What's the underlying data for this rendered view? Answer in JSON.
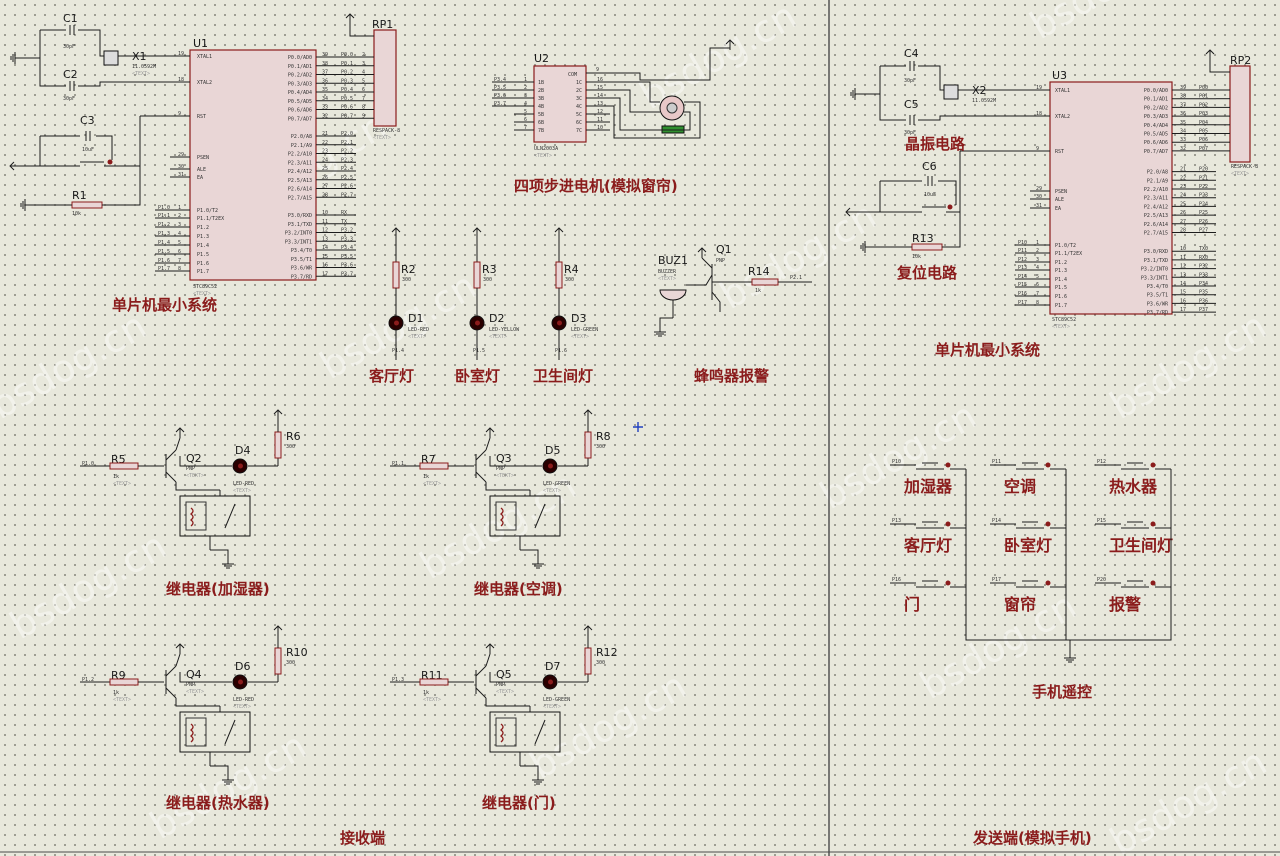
{
  "watermark": "bsdog.cn",
  "placeholder": "<TEXT>",
  "receiver": {
    "footer": "接收端",
    "mcu_section": "单片机最小系统",
    "stepper_section": "四项步进电机(模拟窗帘)",
    "buzzer_section": "蜂鸣器报警",
    "light_labels": [
      "客厅灯",
      "卧室灯",
      "卫生间灯"
    ],
    "relay_labels": [
      "继电器(加湿器)",
      "继电器(空调)",
      "继电器(热水器)",
      "继电器(门)"
    ]
  },
  "sender": {
    "footer": "发送端(模拟手机)",
    "mcu_section": "单片机最小系统",
    "crystal_label": "晶振电路",
    "reset_label": "复位电路",
    "remote_label": "手机遥控",
    "buttons": [
      "加湿器",
      "空调",
      "热水器",
      "客厅灯",
      "卧室灯",
      "卫生间灯",
      "门",
      "窗帘",
      "报警"
    ],
    "button_nets": [
      "P10",
      "P11",
      "P12",
      "P13",
      "P14",
      "P15",
      "P16",
      "P17",
      "P20"
    ]
  },
  "mcu_u1": {
    "ref": "U1",
    "part": "STC89C52",
    "left_pins": [
      "XTAL1",
      "XTAL2",
      "RST",
      "PSEN",
      "ALE",
      "EA",
      "P1.0/T2",
      "P1.1/T2EX",
      "P1.2",
      "P1.3",
      "P1.4",
      "P1.5",
      "P1.6",
      "P1.7"
    ],
    "left_nums": [
      "19",
      "18",
      "9",
      "29",
      "30",
      "31",
      "1",
      "2",
      "3",
      "4",
      "5",
      "6",
      "7",
      "8"
    ],
    "right_pins": [
      "P0.0/AD0",
      "P0.1/AD1",
      "P0.2/AD2",
      "P0.3/AD3",
      "P0.4/AD4",
      "P0.5/AD5",
      "P0.6/AD6",
      "P0.7/AD7",
      "P2.0/A8",
      "P2.1/A9",
      "P2.2/A10",
      "P2.3/A11",
      "P2.4/A12",
      "P2.5/A13",
      "P2.6/A14",
      "P2.7/A15",
      "P3.0/RXD",
      "P3.1/TXD",
      "P3.2/INT0",
      "P3.3/INT1",
      "P3.4/T0",
      "P3.5/T1",
      "P3.6/WR",
      "P3.7/RD"
    ],
    "right_nums": [
      "39",
      "38",
      "37",
      "36",
      "35",
      "34",
      "33",
      "32",
      "21",
      "22",
      "23",
      "24",
      "25",
      "26",
      "27",
      "28",
      "10",
      "11",
      "12",
      "13",
      "14",
      "15",
      "16",
      "17"
    ],
    "p0_nets": [
      "P0.0",
      "P0.1",
      "P0.2",
      "P0.3",
      "P0.4",
      "P0.5",
      "P0.6",
      "P0.7"
    ],
    "p2_nets": [
      "P2.0",
      "P2.1",
      "P2.2",
      "P2.3",
      "P2.4",
      "P2.5",
      "P2.6",
      "P2.7"
    ],
    "p3_nets": [
      "RX",
      "TX",
      "P3.2",
      "P3.3",
      "P3.4",
      "P3.5",
      "P3.6",
      "P3.7"
    ],
    "p1_nets": [
      "P1.0",
      "P1.1",
      "P1.2",
      "P1.3",
      "P1.4",
      "P1.5",
      "P1.6",
      "P1.7"
    ]
  },
  "mcu_u3": {
    "ref": "U3",
    "part": "STC89C52",
    "p0_nets": [
      "P00",
      "P01",
      "P02",
      "P03",
      "P04",
      "P05",
      "P06",
      "P07"
    ],
    "p2_nets": [
      "P20",
      "P21",
      "P22",
      "P23",
      "P24",
      "P25",
      "P26",
      "P27"
    ],
    "p3_nets": [
      "TX0",
      "RX0",
      "P32",
      "P33",
      "P34",
      "P35",
      "P36",
      "P37"
    ],
    "p1_nets": [
      "P10",
      "P11",
      "P12",
      "P13",
      "P14",
      "P15",
      "P16",
      "P17"
    ]
  },
  "parts": {
    "c1": "C1",
    "c2": "C2",
    "c3": "C3",
    "c4": "C4",
    "c5": "C5",
    "c6": "C6",
    "cap_small": "30pF",
    "cap_big": "10uF",
    "x1": "X1",
    "x2": "X2",
    "crystal_val": "11.0592M",
    "r1": "R1",
    "r13": "R13",
    "r_10k": "10k",
    "rp1": "RP1",
    "rp2": "RP2",
    "respack": "RESPACK-8",
    "u2": "U2",
    "uln": "ULN2003A",
    "uln_left": [
      "1",
      "2",
      "3",
      "4",
      "5",
      "6",
      "7"
    ],
    "uln_in": [
      "1B",
      "2B",
      "3B",
      "4B",
      "5B",
      "6B",
      "7B"
    ],
    "uln_out": [
      "1C",
      "2C",
      "3C",
      "4C",
      "5C",
      "6C",
      "7C"
    ],
    "uln_right_nums": [
      "16",
      "15",
      "14",
      "13",
      "12",
      "11",
      "10"
    ],
    "uln_com": "COM",
    "uln_com_num": "9",
    "uln_nets": [
      "P3.4",
      "P3.5",
      "P3.6",
      "P3.7"
    ],
    "leds": [
      {
        "r": "R2",
        "rv": "300",
        "d": "D1",
        "dv": "LED-RED",
        "net": "P1.4"
      },
      {
        "r": "R3",
        "rv": "300",
        "d": "D2",
        "dv": "LED-YELLOW",
        "net": "P1.5"
      },
      {
        "r": "R4",
        "rv": "300",
        "d": "D3",
        "dv": "LED-GREEN",
        "net": "P1.6"
      }
    ],
    "buz": "BUZ1",
    "buz_val": "BUZZER",
    "q1": "Q1",
    "pnp": "PNP",
    "r14": "R14",
    "r14v": "1k",
    "r14net": "P2.1",
    "relays": [
      {
        "r": "R5",
        "net": "P1.0",
        "q": "Q2",
        "d": "D4",
        "dv": "LED-RED",
        "rr": "R6"
      },
      {
        "r": "R7",
        "net": "P1.1",
        "q": "Q3",
        "d": "D5",
        "dv": "LED-GREEN",
        "rr": "R8"
      },
      {
        "r": "R9",
        "net": "P1.2",
        "q": "Q4",
        "d": "D6",
        "dv": "LED-RED",
        "rr": "R10"
      },
      {
        "r": "R11",
        "net": "P1.3",
        "q": "Q5",
        "d": "D7",
        "dv": "LED-GREEN",
        "rr": "R12"
      }
    ],
    "relay_rv": "1k",
    "relay_rrv": "300"
  }
}
